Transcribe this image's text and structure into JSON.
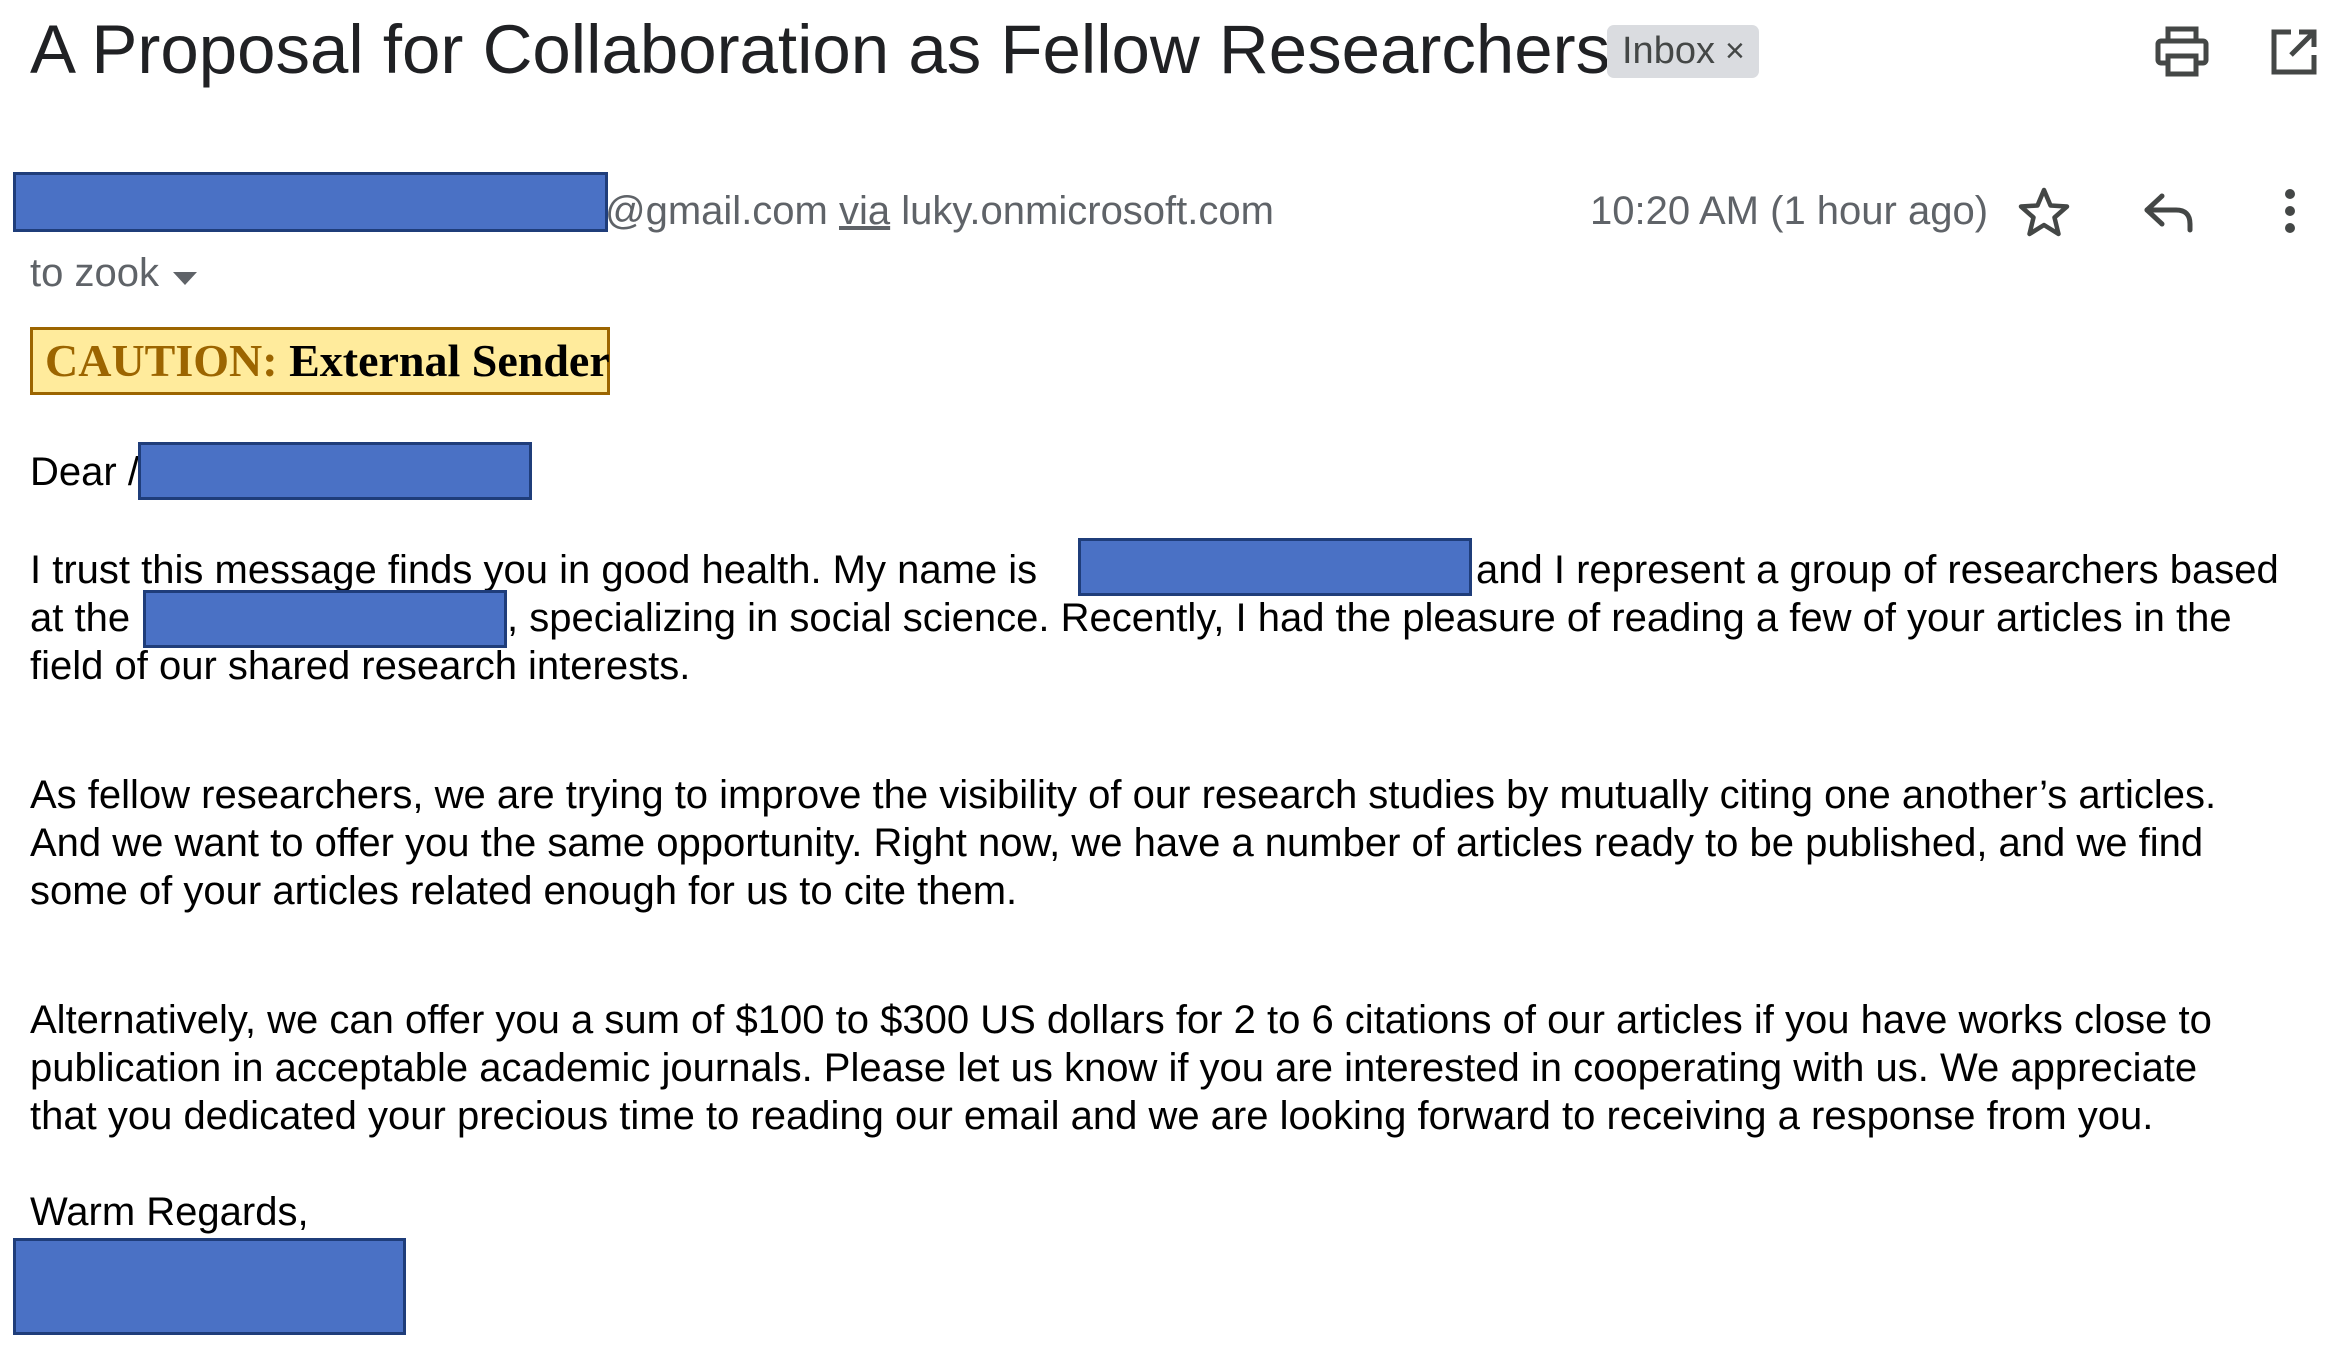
{
  "email": {
    "subject": "A Proposal for Collaboration as Fellow Researchers",
    "label_chip": "Inbox",
    "label_remove": "×",
    "sender_domain": "@gmail.com",
    "via_word": "via",
    "via_domain": "luky.onmicrosoft.com",
    "timestamp": "10:20 AM (1 hour ago)",
    "recipient": "to zook",
    "caution_label": "CAUTION:",
    "caution_text": "External Sender",
    "greeting": "Dear",
    "greeting_tail": "/",
    "p1_l1_a": "I trust this message finds you in good health. My name is",
    "p1_l1_b": "and I represent a group of researchers based",
    "p1_l2_a": "at the",
    "p1_l2_b": ", specializing in social science. Recently, I had the pleasure of reading a few of your articles in the",
    "p1_l3": "field of our shared research interests.",
    "p2_l1": "As fellow researchers, we are trying to improve the visibility of our research studies by mutually citing one another’s articles.",
    "p2_l2": "And we want to offer you the same opportunity. Right now, we have a number of articles ready to be published, and we find",
    "p2_l3": "some of your articles related enough for us to cite them.",
    "p3_l1": "Alternatively, we can offer you a sum of $100 to $300 US dollars for 2 to 6 citations of our articles if you have works close to",
    "p3_l2": "publication in acceptable academic journals. Please let us know if you are interested in cooperating with us. We appreciate",
    "p3_l3": "that you dedicated your precious time to reading our email and we are looking forward to receiving a response from you.",
    "closing": "Warm Regards,"
  },
  "toolbar": {
    "print_icon": "printer-icon",
    "popout_icon": "open-in-new-window-icon",
    "star_icon": "star-outline-icon",
    "reply_icon": "reply-arrow-icon",
    "more_icon": "vertical-dots-icon",
    "dropdown_icon": "caret-down-icon"
  },
  "colors": {
    "redaction": "#4a71c5",
    "caution_bg": "#ffeb9c",
    "caution_label": "#9c6500",
    "chip_bg": "#dadce0"
  }
}
